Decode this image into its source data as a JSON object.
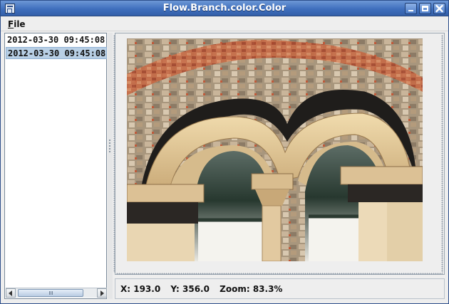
{
  "window": {
    "title": "Flow.Branch.color.Color"
  },
  "menubar": {
    "file_label": "ile",
    "file_mnemonic": "F"
  },
  "list": {
    "items": [
      "2012-03-30 09:45:08.",
      "2012-03-30 09:45:08."
    ],
    "selected_index": 1
  },
  "status": {
    "x": "X: 193.0",
    "y": "Y: 356.0",
    "zoom": "Zoom: 83.3%"
  },
  "icons": [
    "app-icon",
    "minimize-icon",
    "maximize-icon",
    "close-icon",
    "scroll-left-icon",
    "scroll-right-icon"
  ],
  "colors": {
    "titlebar": "#3f6fbd",
    "selection": "#b8cfe5"
  }
}
